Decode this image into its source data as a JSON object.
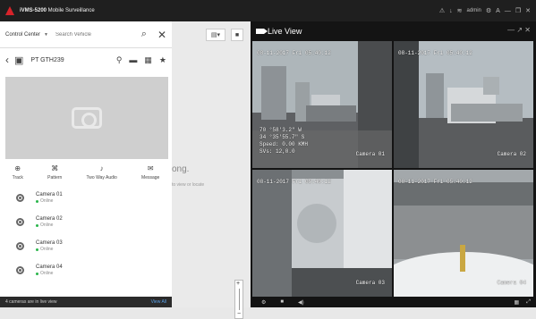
{
  "window": {
    "title_bold": "iVMS-5200",
    "title_rest": " Mobile Surveillance",
    "user": "admin",
    "icons": [
      "alarm-icon",
      "download-icon",
      "wifi-icon",
      "user-icon",
      "settings-icon",
      "lock-icon",
      "minimize-icon",
      "restore-icon",
      "close-icon"
    ]
  },
  "left_panel": {
    "control_center": "Control Center",
    "search_placeholder": "Search Vehicle",
    "vehicle_plate": "PT GTH239",
    "actions": [
      {
        "icon": "track-icon",
        "label": "Track"
      },
      {
        "icon": "pattern-icon",
        "label": "Pattern"
      },
      {
        "icon": "microphone-icon",
        "label": "Two Way Audio"
      },
      {
        "icon": "message-icon",
        "label": "Message"
      }
    ],
    "cameras": [
      {
        "name": "Camera 01",
        "status": "Online"
      },
      {
        "name": "Camera 02",
        "status": "Online"
      },
      {
        "name": "Camera 03",
        "status": "Online"
      },
      {
        "name": "Camera 04",
        "status": "Online"
      }
    ],
    "footer_text": "4 cameras are in live view",
    "view_all": "View All"
  },
  "map": {
    "partial_text": "ong.",
    "partial_subtext": "to view or locate",
    "zoom_in": "+",
    "zoom_out": "−"
  },
  "live_view": {
    "title": "Live View",
    "tiles": [
      {
        "timestamp": "08-11-2017 Fri 05:40:12",
        "camera": "Camera 01",
        "gps": [
          "70 °58'3.2\" W",
          "34 °35'55.7\" S",
          "Speed: 0.00 KMH",
          "SVs: 12,0.0"
        ]
      },
      {
        "timestamp": "08-11-2017 Fri 05:40:12",
        "camera": "Camera 02"
      },
      {
        "timestamp": "08-11-2017 Fri 05:40:12",
        "camera": "Camera 03"
      },
      {
        "timestamp": "08-11-2017 Fri 05:40:12",
        "camera": "Camera 04"
      }
    ],
    "colors": {
      "panel_bg": "#141414",
      "titlebar_bg": "#1f1f1f",
      "online": "#2bb54b",
      "link": "#5aa0e6"
    }
  }
}
